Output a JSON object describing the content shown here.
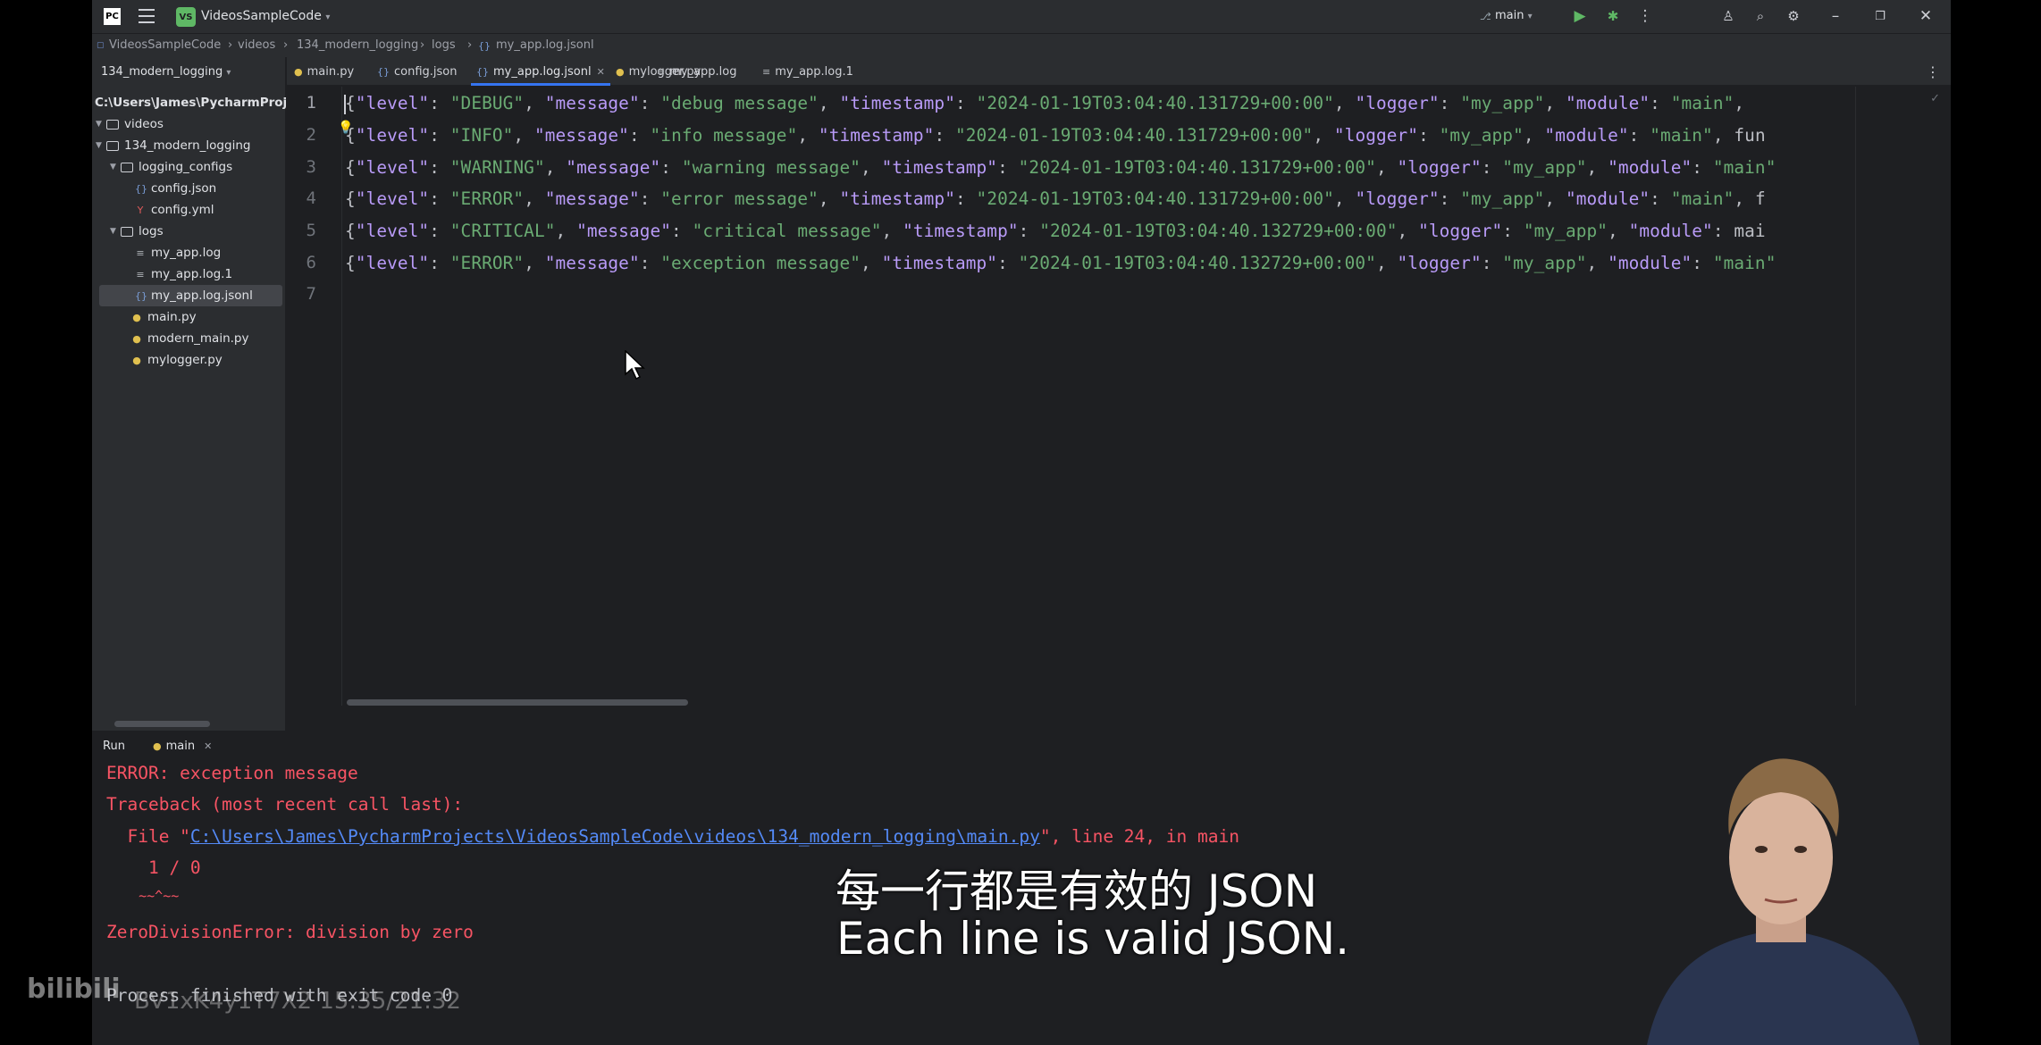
{
  "titlebar": {
    "ide_logo": "PC",
    "project_badge": "VS",
    "project_name": "VideosSampleCode",
    "branch": "main"
  },
  "breadcrumb": [
    "VideosSampleCode",
    "videos",
    "134_modern_logging",
    "logs",
    "my_app.log.jsonl"
  ],
  "project_pane": {
    "header": "134_modern_logging",
    "root_path": "C:\\Users\\James\\PycharmProjec",
    "tree": [
      {
        "label": "videos",
        "kind": "folder",
        "icon": "folder-icon"
      },
      {
        "label": "134_modern_logging",
        "kind": "folder",
        "icon": "folder-icon"
      },
      {
        "label": "logging_configs",
        "kind": "folder",
        "icon": "folder-icon"
      },
      {
        "label": "config.json",
        "kind": "json",
        "icon": "json-file-icon"
      },
      {
        "label": "config.yml",
        "kind": "yml",
        "icon": "yaml-file-icon"
      },
      {
        "label": "logs",
        "kind": "folder",
        "icon": "folder-icon"
      },
      {
        "label": "my_app.log",
        "kind": "log",
        "icon": "text-file-icon"
      },
      {
        "label": "my_app.log.1",
        "kind": "log",
        "icon": "text-file-icon"
      },
      {
        "label": "my_app.log.jsonl",
        "kind": "json",
        "icon": "json-file-icon",
        "selected": true
      },
      {
        "label": "main.py",
        "kind": "py",
        "icon": "python-file-icon"
      },
      {
        "label": "modern_main.py",
        "kind": "py",
        "icon": "python-file-icon"
      },
      {
        "label": "mylogger.py",
        "kind": "py",
        "icon": "python-file-icon"
      }
    ]
  },
  "tabs": [
    {
      "label": "main.py",
      "icon": "python-file-icon"
    },
    {
      "label": "config.json",
      "icon": "json-file-icon"
    },
    {
      "label": "my_app.log.jsonl",
      "icon": "json-file-icon",
      "active": true
    },
    {
      "label": "mylogger.py",
      "icon": "python-file-icon"
    },
    {
      "label": "my_app.log",
      "icon": "text-file-icon"
    },
    {
      "label": "my_app.log.1",
      "icon": "text-file-icon"
    }
  ],
  "editor": {
    "line_numbers": [
      "1",
      "2",
      "3",
      "4",
      "5",
      "6",
      "7"
    ],
    "lines": [
      "{\"level\": \"DEBUG\", \"message\": \"debug message\", \"timestamp\": \"2024-01-19T03:04:40.131729+00:00\", \"logger\": \"my_app\", \"module\": \"main\",",
      "{\"level\": \"INFO\", \"message\": \"info message\", \"timestamp\": \"2024-01-19T03:04:40.131729+00:00\", \"logger\": \"my_app\", \"module\": \"main\", \"fun",
      "{\"level\": \"WARNING\", \"message\": \"warning message\", \"timestamp\": \"2024-01-19T03:04:40.131729+00:00\", \"logger\": \"my_app\", \"module\": \"main\"",
      "{\"level\": \"ERROR\", \"message\": \"error message\", \"timestamp\": \"2024-01-19T03:04:40.131729+00:00\", \"logger\": \"my_app\", \"module\": \"main\", \"f",
      "{\"level\": \"CRITICAL\", \"message\": \"critical message\", \"timestamp\": \"2024-01-19T03:04:40.132729+00:00\", \"logger\": \"my_app\", \"module\": \"mai",
      "{\"level\": \"ERROR\", \"message\": \"exception message\", \"timestamp\": \"2024-01-19T03:04:40.132729+00:00\", \"logger\": \"my_app\", \"module\": \"main\"",
      ""
    ]
  },
  "run_panel": {
    "title": "Run",
    "tab": "main"
  },
  "console": {
    "error_line": "ERROR: exception message",
    "traceback": "Traceback (most recent call last):",
    "file_prefix": "  File \"",
    "file_path": "C:\\Users\\James\\PycharmProjects\\VideosSampleCode\\videos\\134_modern_logging\\main.py",
    "file_suffix": "\", line 24, in main",
    "code": "    1 / 0",
    "carets": "    ~~^~~",
    "exception": "ZeroDivisionError: division by zero",
    "exit": "Process finished with exit code 0"
  },
  "subtitles": {
    "chinese": "每一行都是有效的 JSON",
    "english": "Each line is valid JSON."
  },
  "watermark": {
    "brand": "bilibili",
    "id": "BV1xK4y1T7X2 15:35/21:32"
  },
  "colors": {
    "json_key": "#b99bf8",
    "json_string": "#6aab73",
    "console_error": "#f75464",
    "link": "#548af7",
    "accent": "#3574f0"
  }
}
